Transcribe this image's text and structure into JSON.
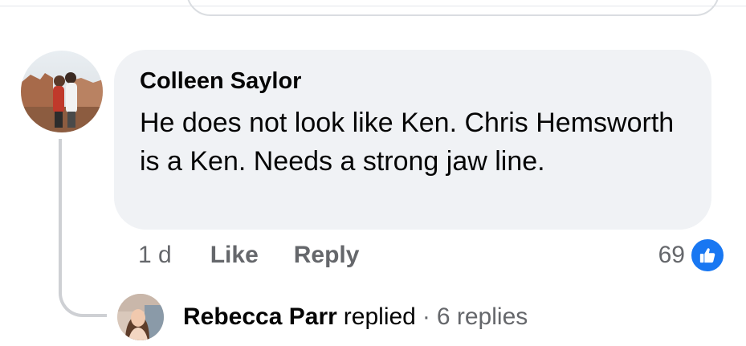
{
  "comment": {
    "author": "Colleen Saylor",
    "text": "He does not look like Ken. Chris Hemsworth is a Ken. Needs a strong jaw line.",
    "time": "1 d",
    "like_label": "Like",
    "reply_label": "Reply",
    "reaction_count": "69",
    "reaction_icon": "thumbs-up-icon",
    "reaction_color": "#1877f2"
  },
  "reply_summary": {
    "name": "Rebecca Parr",
    "verb": "replied",
    "separator": "·",
    "count_text": "6 replies"
  }
}
